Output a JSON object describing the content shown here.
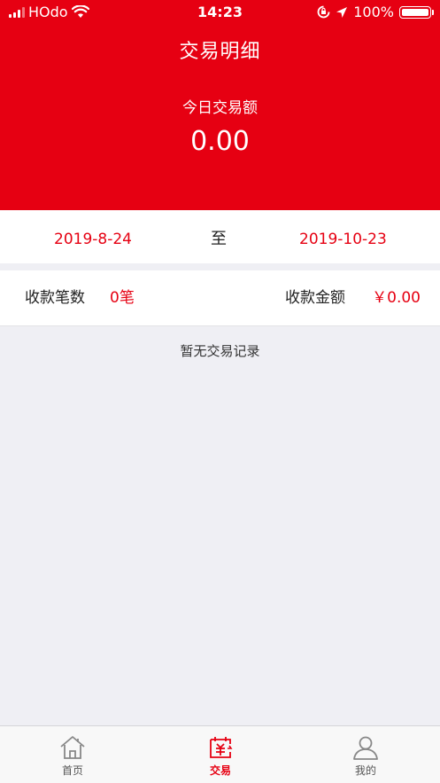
{
  "status_bar": {
    "carrier": "HOdo",
    "time": "14:23",
    "battery_percent": "100%",
    "icons": [
      "signal-icon",
      "wifi-icon",
      "rotation-lock-icon",
      "location-arrow-icon",
      "battery-icon"
    ]
  },
  "header": {
    "title": "交易明细",
    "today_label": "今日交易额",
    "today_amount": "0.00"
  },
  "date_range": {
    "start": "2019-8-24",
    "separator": "至",
    "end": "2019-10-23"
  },
  "summary": {
    "count_label": "收款笔数",
    "count_value": "0笔",
    "amount_label": "收款金额",
    "amount_value": "￥0.00"
  },
  "empty_text": "暂无交易记录",
  "tabbar": {
    "items": [
      {
        "label": "首页",
        "icon": "home-icon",
        "active": false
      },
      {
        "label": "交易",
        "icon": "trade-calendar-icon",
        "active": true
      },
      {
        "label": "我的",
        "icon": "user-icon",
        "active": false
      }
    ]
  },
  "colors": {
    "brand_red": "#e60012",
    "background": "#efeff4"
  }
}
